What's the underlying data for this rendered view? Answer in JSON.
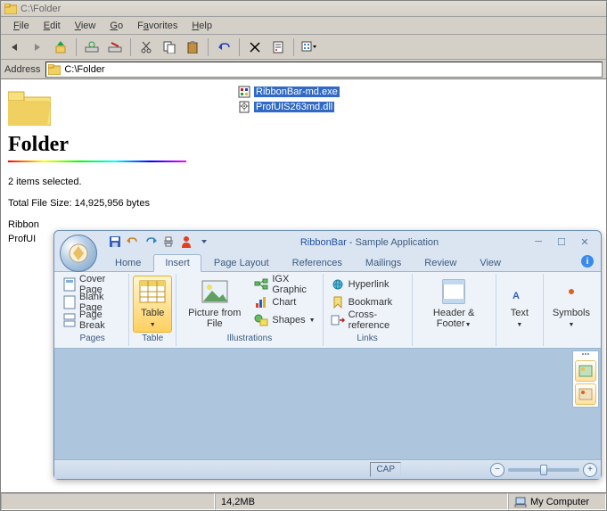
{
  "explorer": {
    "title": "C:\\Folder",
    "menus": [
      "File",
      "Edit",
      "View",
      "Go",
      "Favorites",
      "Help"
    ],
    "address_label": "Address",
    "address_value": "C:\\Folder",
    "folder_name": "Folder",
    "sel_text": "2 items selected.",
    "size_text": "Total File Size: 14,925,956 bytes",
    "cutoff1": "Ribbon",
    "cutoff2": "ProfUI",
    "files": [
      {
        "name": "RibbonBar-md.exe"
      },
      {
        "name": "ProfUIS263md.dll"
      }
    ],
    "status_size": "14,2MB",
    "status_loc": "My Computer"
  },
  "ribbon": {
    "title_app": "RibbonBar",
    "title_doc": " - Sample Application",
    "tabs": [
      "Home",
      "Insert",
      "Page Layout",
      "References",
      "Mailings",
      "Review",
      "View"
    ],
    "active_tab": 1,
    "groups": {
      "pages": {
        "label": "Pages",
        "items": [
          "Cover Page",
          "Blank Page",
          "Page Break"
        ]
      },
      "table": {
        "label": "Table",
        "btn": "Table"
      },
      "illustrations": {
        "label": "Illustrations",
        "pic": "Picture from File",
        "igx": "IGX Graphic",
        "chart": "Chart",
        "shapes": "Shapes"
      },
      "links": {
        "label": "Links",
        "hyperlink": "Hyperlink",
        "bookmark": "Bookmark",
        "xref": "Cross-reference"
      },
      "hf": {
        "label": "",
        "btn": "Header & Footer"
      },
      "text": {
        "label": "",
        "btn": "Text"
      },
      "symbols": {
        "label": "",
        "btn": "Symbols"
      }
    },
    "cap": "CAP"
  }
}
